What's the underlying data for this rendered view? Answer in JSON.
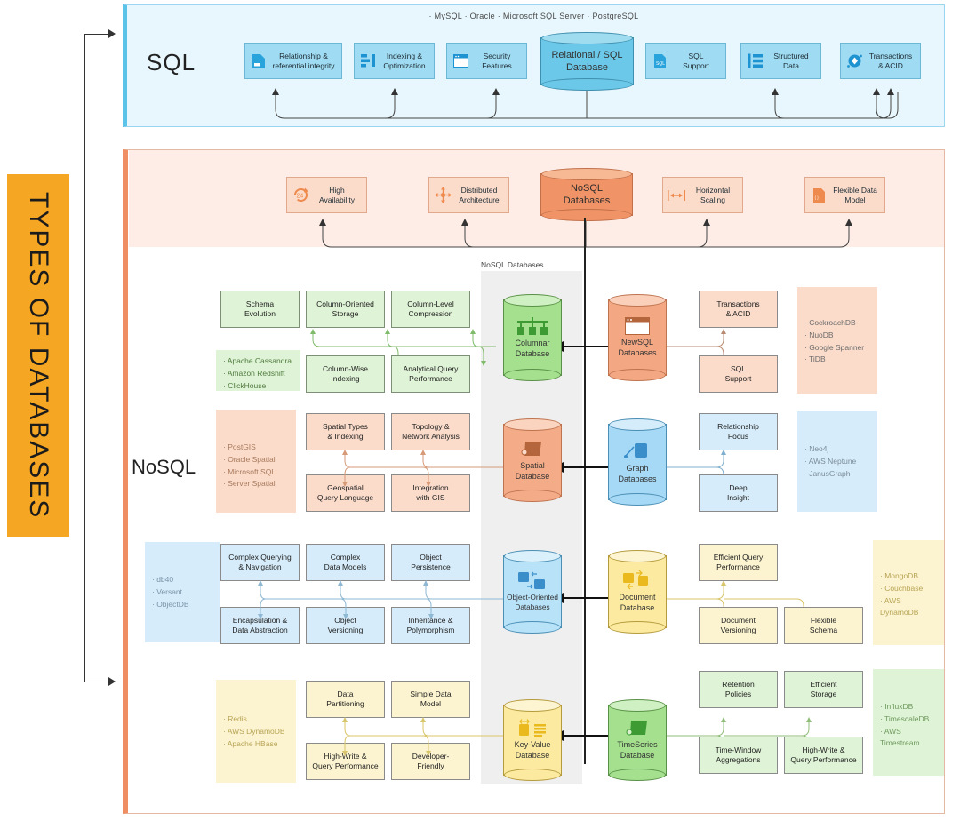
{
  "side_title": "TYPES OF DATABASES",
  "colors": {
    "sql_accent": "#5BC3E8",
    "sql_panel_bg": "#E8F7FD",
    "sql_chip": "#9FDBF2",
    "nosql_accent": "#EF8E62",
    "nosql_panel_bg": "#FDEDE6",
    "title_bg": "#F5A623",
    "green": "#D9F2D0",
    "orange": "#FBDCCB",
    "blue": "#D6ECFA",
    "yellow": "#FCF4D0",
    "spine_band": "#EFEFEF"
  },
  "sql": {
    "label": "SQL",
    "vendors": "· MySQL  · Oracle  · Microsoft SQL Server  · PostgreSQL",
    "center": {
      "title_line1": "Relational / SQL",
      "title_line2": "Database",
      "icon": "database-cylinder-icon"
    },
    "features": [
      {
        "line1": "Relationship &",
        "line2": "referential integrity",
        "icon": "document-icon"
      },
      {
        "line1": "Indexing &",
        "line2": "Optimization",
        "icon": "bar-list-icon"
      },
      {
        "line1": "Security",
        "line2": "Features",
        "icon": "window-icon"
      },
      {
        "line1": "SQL",
        "line2": "Support",
        "icon": "sql-file-icon"
      },
      {
        "line1": "Structured",
        "line2": "Data",
        "icon": "rows-icon"
      },
      {
        "line1": "Transactions",
        "line2": "& ACID",
        "icon": "diamond-node-icon"
      }
    ]
  },
  "nosql": {
    "label": "NoSQL",
    "center": {
      "title_line1": "NoSQL",
      "title_line2": "Databases"
    },
    "features": [
      {
        "line1": "High",
        "line2": "Availability",
        "icon": "24-7-icon"
      },
      {
        "line1": "Distributed",
        "line2": "Architecture",
        "icon": "four-arrows-icon"
      },
      {
        "line1": "Horizontal",
        "line2": "Scaling",
        "icon": "horizontal-resize-icon"
      },
      {
        "line1": "Flexible Data",
        "line2": "Model",
        "icon": "flexible-file-icon"
      }
    ],
    "spine_label": "NoSQL Databases",
    "rows": [
      {
        "left": {
          "db_line1": "Columnar",
          "db_line2": "Database",
          "theme": "green",
          "icon": "column-tree-icon",
          "top_boxes": [
            {
              "line1": "Schema",
              "line2": "Evolution"
            },
            {
              "line1": "Column-Oriented",
              "line2": "Storage"
            },
            {
              "line1": "Column-Level",
              "line2": "Compression"
            }
          ],
          "bottom_boxes": [
            {
              "line1": "Column-Wise",
              "line2": "Indexing"
            },
            {
              "line1": "Analytical Query",
              "line2": "Performance"
            }
          ],
          "vendors": [
            "· Apache Cassandra",
            "· Amazon Redshift",
            "· ClickHouse"
          ]
        },
        "right": {
          "db_line1": "NewSQL",
          "db_line2": "Databases",
          "theme": "orange",
          "icon": "window-icon",
          "top_boxes": [
            {
              "line1": "Transactions",
              "line2": "& ACID"
            }
          ],
          "bottom_boxes": [
            {
              "line1": "SQL",
              "line2": "Support"
            }
          ],
          "vendors": [
            "· CockroachDB",
            "· NuoDB",
            "· Google Spanner",
            "· TiDB"
          ]
        }
      },
      {
        "left": {
          "db_line1": "Spatial",
          "db_line2": "Database",
          "theme": "orange",
          "icon": "map-shape-icon",
          "top_boxes": [
            {
              "line1": "Spatial Types",
              "line2": "& Indexing"
            },
            {
              "line1": "Topology &",
              "line2": "Network Analysis"
            }
          ],
          "bottom_boxes": [
            {
              "line1": "Geospatial",
              "line2": "Query Language"
            },
            {
              "line1": "Integration",
              "line2": "with GIS"
            }
          ],
          "vendors": [
            "· PostGIS",
            "· Oracle Spatial",
            "· Microsoft SQL",
            "· Server Spatial"
          ]
        },
        "right": {
          "db_line1": "Graph",
          "db_line2": "Databases",
          "theme": "blue",
          "icon": "graph-node-icon",
          "top_boxes": [
            {
              "line1": "Relationship",
              "line2": "Focus"
            }
          ],
          "bottom_boxes": [
            {
              "line1": "Deep",
              "line2": "Insight"
            }
          ],
          "vendors": [
            "· Neo4j",
            "· AWS Neptune",
            "· JanusGraph"
          ]
        }
      },
      {
        "left": {
          "db_line1": "Object-Oriented",
          "db_line2": "Databases",
          "theme": "blue",
          "icon": "objects-icon",
          "top_boxes": [
            {
              "line1": "Complex Querying",
              "line2": "& Navigation"
            },
            {
              "line1": "Complex",
              "line2": "Data Models"
            },
            {
              "line1": "Object",
              "line2": "Persistence"
            }
          ],
          "bottom_boxes": [
            {
              "line1": "Encapsulation &",
              "line2": "Data Abstraction"
            },
            {
              "line1": "Object",
              "line2": "Versioning"
            },
            {
              "line1": "Inheritance &",
              "line2": "Polymorphism"
            }
          ],
          "vendors": [
            "· db40",
            "· Versant",
            "· ObjectDB"
          ]
        },
        "right": {
          "db_line1": "Document",
          "db_line2": "Database",
          "theme": "yellow",
          "icon": "documents-icon",
          "top_boxes": [
            {
              "line1": "Efficient Query",
              "line2": "Performance"
            }
          ],
          "bottom_boxes": [
            {
              "line1": "Document",
              "line2": "Versioning"
            },
            {
              "line1": "Flexible",
              "line2": "Schema"
            }
          ],
          "vendors": [
            "· MongoDB",
            "· Couchbase",
            "· AWS",
            "   DynamoDB"
          ]
        }
      },
      {
        "left": {
          "db_line1": "Key-Value",
          "db_line2": "Database",
          "theme": "yellow",
          "icon": "key-value-icon",
          "top_boxes": [
            {
              "line1": "Data",
              "line2": "Partitioning"
            },
            {
              "line1": "Simple Data",
              "line2": "Model"
            }
          ],
          "bottom_boxes": [
            {
              "line1": "High-Write &",
              "line2": "Query Performance"
            },
            {
              "line1": "Developer-",
              "line2": "Friendly"
            }
          ],
          "vendors": [
            "· Redis",
            "· AWS DynamoDB",
            "· Apache HBase"
          ]
        },
        "right": {
          "db_line1": "TimeSeries",
          "db_line2": "Database",
          "theme": "green",
          "icon": "timeseries-icon",
          "top_boxes": [
            {
              "line1": "Retention",
              "line2": "Policies"
            },
            {
              "line1": "Efficient",
              "line2": "Storage"
            }
          ],
          "bottom_boxes": [
            {
              "line1": "Time-Window",
              "line2": "Aggregations"
            },
            {
              "line1": "High-Write &",
              "line2": "Query Performance"
            }
          ],
          "vendors": [
            "· InfluxDB",
            "· TimescaleDB",
            "· AWS",
            "   Timestream"
          ]
        }
      }
    ]
  }
}
